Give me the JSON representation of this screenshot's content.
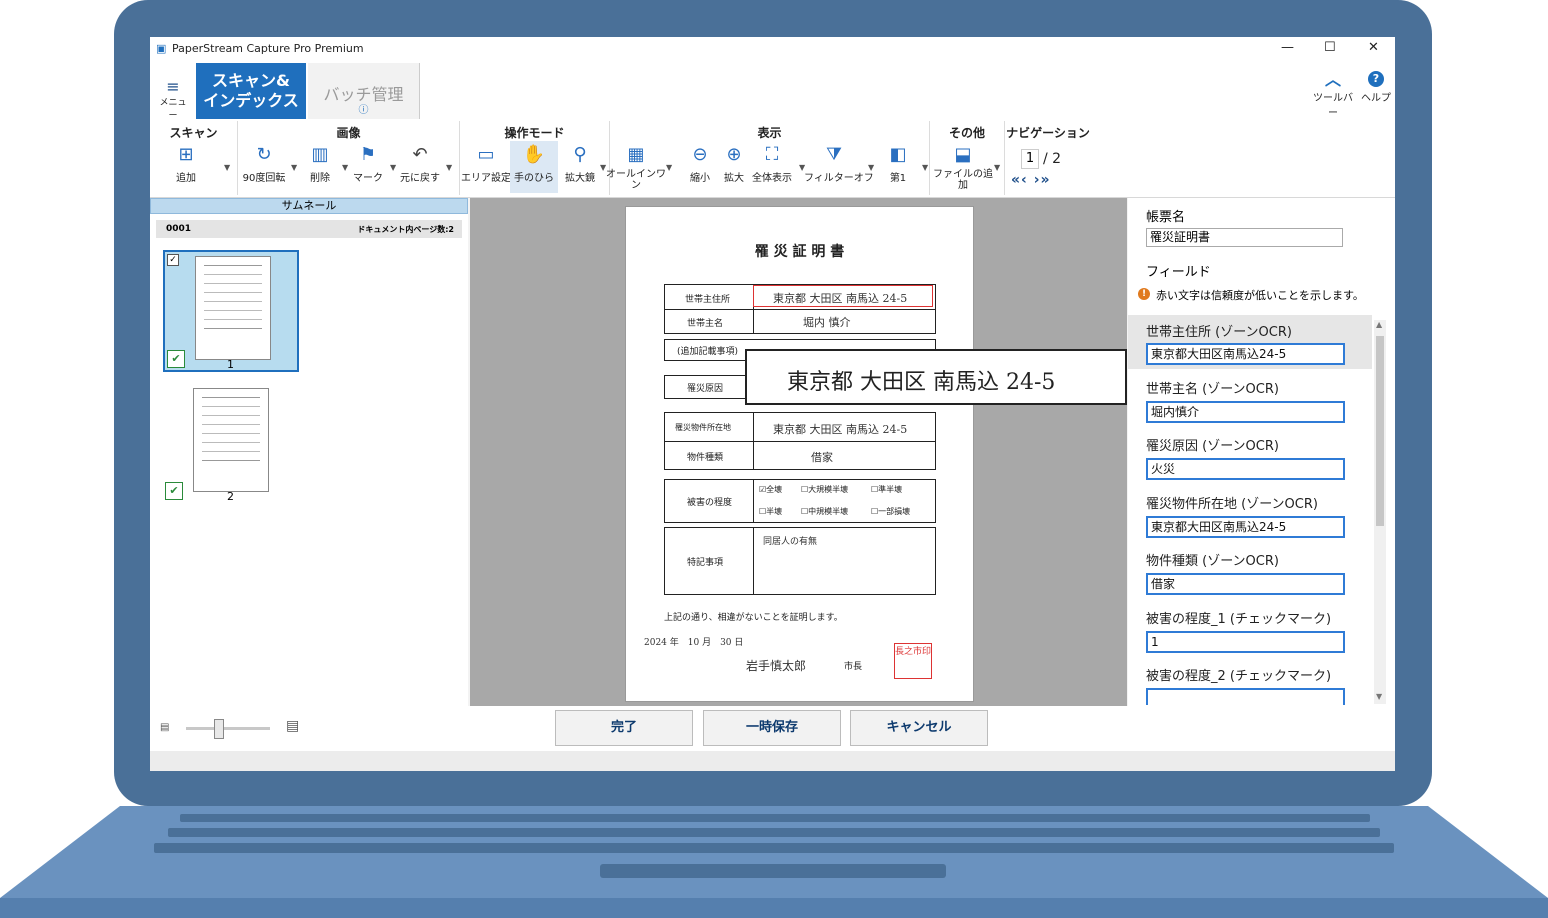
{
  "app": {
    "title": "PaperStream Capture Pro Premium",
    "window_controls": [
      "—",
      "☐",
      "✕"
    ]
  },
  "ribbon_tabs": {
    "menu_label": "メニュー",
    "active_tab": "スキャン&\nインデックス",
    "active_tab_line1": "スキャン&",
    "active_tab_line2": "インデックス",
    "batch_tab": "バッチ管理",
    "toolbar_label": "ツールバー",
    "help_label": "ヘルプ"
  },
  "ribbon": {
    "groups": {
      "scan": "スキャン",
      "image": "画像",
      "mode": "操作モード",
      "view": "表示",
      "other": "その他",
      "nav": "ナビゲーション"
    },
    "tools": {
      "add": "追加",
      "rotate": "90度回転",
      "delete": "削除",
      "mark": "マーク",
      "undo": "元に戻す",
      "area": "エリア設定",
      "hand": "手のひら",
      "magnifier": "拡大鏡",
      "overlay_line1": "オールインワ",
      "overlay_line2": "ン",
      "zoom_out": "縮小",
      "zoom_in": "拡大",
      "fit": "全体表示",
      "filter": "フィルターオフ",
      "first": "第1",
      "add_file_line1": "ファイルの追",
      "add_file_line2": "加"
    },
    "nav": {
      "current_page": "1",
      "total_pages": "/ 2"
    }
  },
  "thumbnails": {
    "header": "サムネール",
    "doc_id": "0001",
    "doc_pages": "ドキュメント内ページ数:2",
    "pages": [
      "1",
      "2"
    ]
  },
  "document": {
    "title": "罹 災 証 明 書",
    "labels": {
      "address": "世帯主住所",
      "head": "世帯主名",
      "extra": "(追加記載事項)",
      "cause": "罹災原因",
      "location": "罹災物件所在地",
      "kind": "物件種類",
      "damage": "被害の程度",
      "remarks": "特記事項"
    },
    "values": {
      "address": "東京都 大田区 南馬込 24-5",
      "head": "堀内 慎介",
      "location": "東京都 大田区 南馬込 24-5",
      "kind": "借家",
      "remarks": "同居人の有無"
    },
    "damage_options": [
      "☑全壊",
      "☐大規模半壊",
      "☐準半壊",
      "☐半壊",
      "☐中規模半壊",
      "☐一部損壊"
    ],
    "statement": "上記の通り、相違がないことを証明します。",
    "date": "2024 年　10 月　30 日",
    "signer": "岩手慎太郎",
    "signer_role": "市長",
    "seal": "長之市印",
    "zoom_popup": "東京都 大田区 南馬込 24-5"
  },
  "right_panel": {
    "form_name_label": "帳票名",
    "form_name_value": "罹災証明書",
    "fields_label": "フィールド",
    "warning": "赤い文字は信頼度が低いことを示します。",
    "fields": [
      {
        "label": "世帯主住所 (ゾーンOCR)",
        "value": "東京都大田区南馬込24-5"
      },
      {
        "label": "世帯主名 (ゾーンOCR)",
        "value": "堀内慎介"
      },
      {
        "label": "罹災原因 (ゾーンOCR)",
        "value": "火災"
      },
      {
        "label": "罹災物件所在地 (ゾーンOCR)",
        "value": "東京都大田区南馬込24-5"
      },
      {
        "label": "物件種類 (ゾーンOCR)",
        "value": "借家"
      },
      {
        "label": "被害の程度_1 (チェックマーク)",
        "value": "1"
      },
      {
        "label": "被害の程度_2 (チェックマーク)",
        "value": ""
      }
    ]
  },
  "footer": {
    "finish": "完了",
    "save_temp": "一時保存",
    "cancel": "キャンセル"
  },
  "colors": {
    "laptop": "#4a7098",
    "accent": "#1f6fbd",
    "selected_thumb": "#b7dcef"
  }
}
